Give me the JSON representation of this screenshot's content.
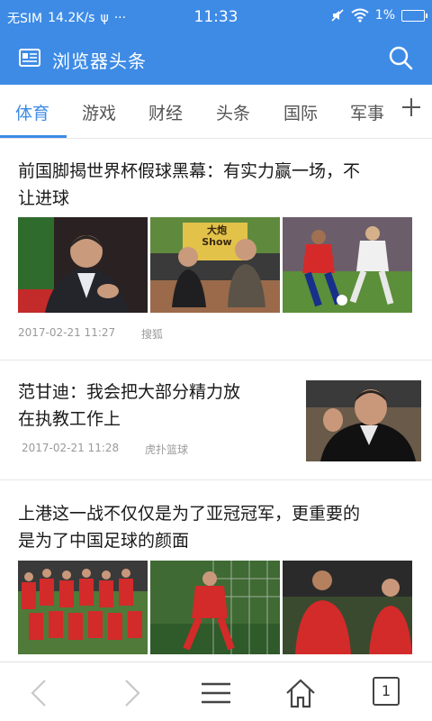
{
  "status_bar": {
    "carrier": "无SIM",
    "speed": "14.2K/s",
    "usb": "ψ",
    "more": "···",
    "time": "11:33",
    "battery": "1%"
  },
  "header": {
    "title": "浏览器头条",
    "icon": "news-icon",
    "search_icon": "search-icon"
  },
  "tabs": [
    {
      "label": "体育",
      "active": true
    },
    {
      "label": "游戏"
    },
    {
      "label": "财经"
    },
    {
      "label": "头条"
    },
    {
      "label": "国际"
    },
    {
      "label": "军事"
    }
  ],
  "articles": [
    {
      "title_line1": "前国脚揭世界杯假球黑幕：有实力赢一场，不",
      "title_line2": "让进球",
      "date": "2017-02-21 11:27",
      "source": "搜狐"
    },
    {
      "title_line1": "范甘迪：我会把大部分精力放",
      "title_line2": "在执教工作上",
      "date": "2017-02-21 11:28",
      "source": "虎扑篮球"
    },
    {
      "title_line1": "上港这一战不仅仅是为了亚冠冠军，更重要的",
      "title_line2": "是为了中国足球的颜面"
    }
  ],
  "thumb_text": {
    "show_sign": "大炮\nShow"
  },
  "bottom_nav": {
    "tab_count": "1"
  },
  "colors": {
    "accent": "#3e8be6"
  }
}
